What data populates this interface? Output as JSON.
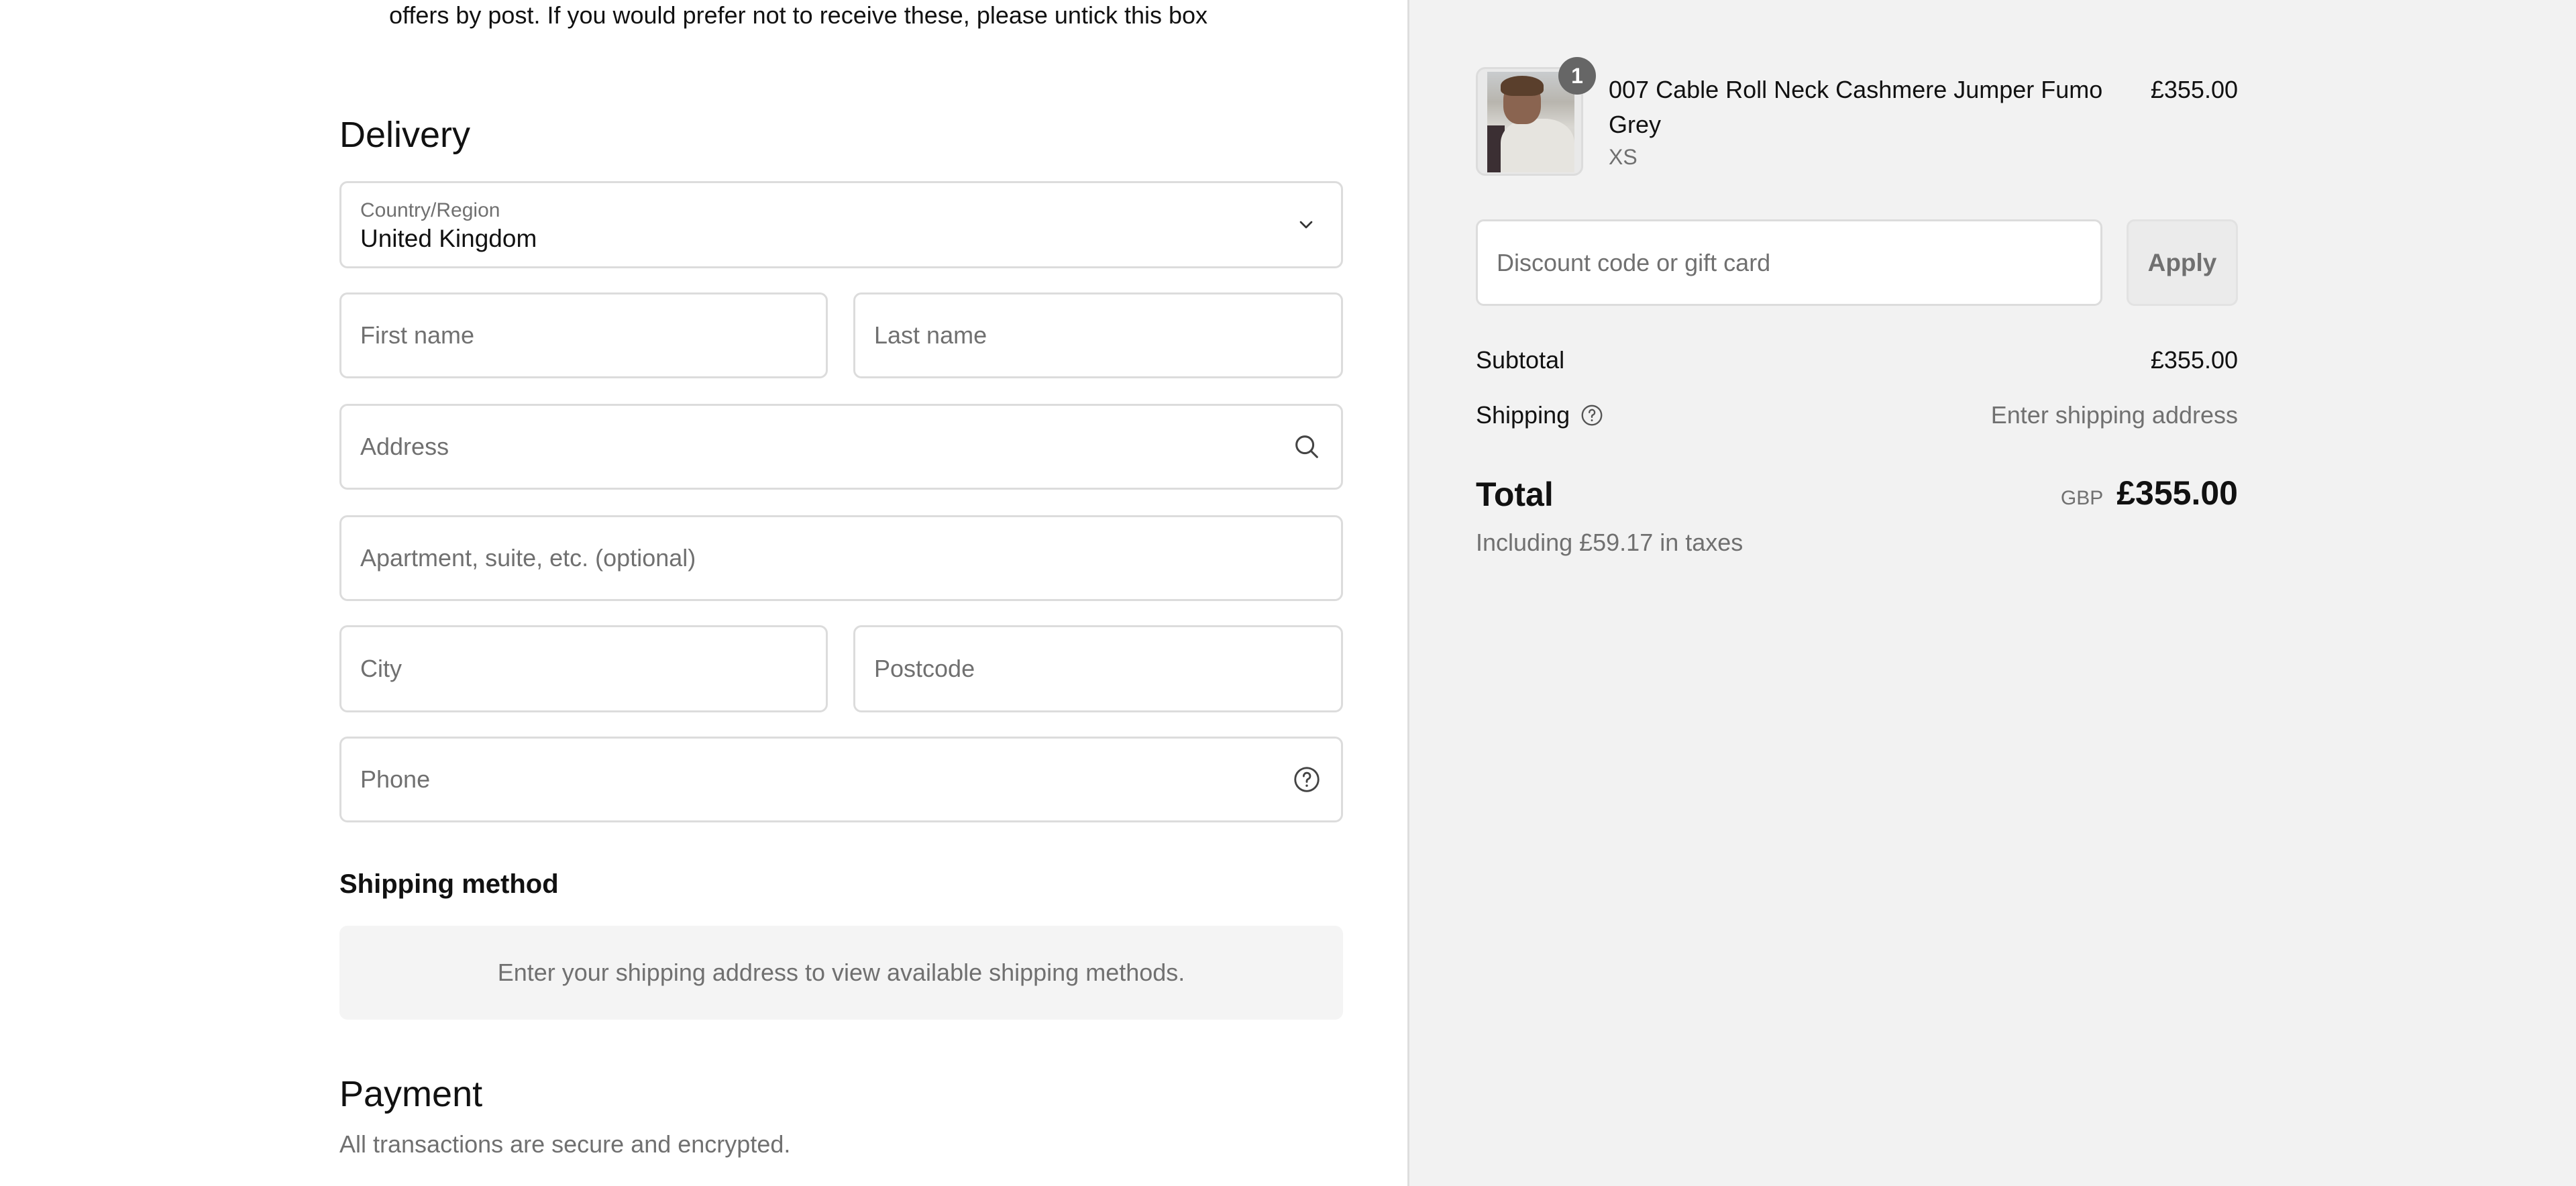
{
  "contact": {
    "consent_text": "offers by post. If you would prefer not to receive these, please untick this box"
  },
  "delivery": {
    "heading": "Delivery",
    "country": {
      "label": "Country/Region",
      "value": "United Kingdom",
      "icon": "chevron-down-icon"
    },
    "fields": {
      "first_name": {
        "placeholder": "First name",
        "value": ""
      },
      "last_name": {
        "placeholder": "Last name",
        "value": ""
      },
      "address": {
        "placeholder": "Address",
        "value": "",
        "icon": "search-icon"
      },
      "apartment": {
        "placeholder": "Apartment, suite, etc. (optional)",
        "value": ""
      },
      "city": {
        "placeholder": "City",
        "value": ""
      },
      "postcode": {
        "placeholder": "Postcode",
        "value": ""
      },
      "phone": {
        "placeholder": "Phone",
        "value": "",
        "icon": "help-circle-icon"
      }
    }
  },
  "shipping_method": {
    "heading": "Shipping method",
    "message": "Enter your shipping address to view available shipping methods."
  },
  "payment": {
    "heading": "Payment",
    "subtitle": "All transactions are secure and encrypted."
  },
  "order_summary": {
    "item": {
      "quantity": "1",
      "title": "007 Cable Roll Neck Cashmere Jumper Fumo Grey",
      "variant": "XS",
      "price": "£355.00"
    },
    "discount": {
      "placeholder": "Discount code or gift card",
      "value": "",
      "apply_label": "Apply"
    },
    "subtotal": {
      "label": "Subtotal",
      "value": "£355.00"
    },
    "shipping": {
      "label": "Shipping",
      "value": "Enter shipping address",
      "icon": "help-circle-icon"
    },
    "total": {
      "label": "Total",
      "currency": "GBP",
      "value": "£355.00"
    },
    "taxes_note": "Including £59.17 in taxes"
  },
  "colors": {
    "right_panel_bg": "#f2f2f2",
    "muted_text": "#707070",
    "border": "#dcdcdc",
    "badge_bg": "#666666"
  }
}
